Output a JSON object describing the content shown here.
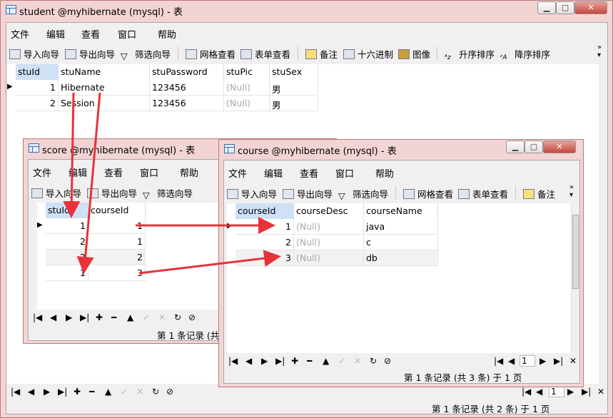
{
  "student": {
    "title": "student @myhibernate (mysql) - 表",
    "menu": [
      "文件",
      "编辑",
      "查看",
      "窗口",
      "帮助"
    ],
    "toolbar": [
      "导入向导",
      "导出向导",
      "筛选向导",
      "网格查看",
      "表单查看",
      "备注",
      "十六进制",
      "图像",
      "升序排序",
      "降序排序"
    ],
    "columns": [
      "stuId",
      "stuName",
      "stuPassword",
      "stuPic",
      "stuSex"
    ],
    "rows": [
      [
        "1",
        "Hibernate",
        "123456",
        "(Null)",
        "男"
      ],
      [
        "2",
        "Session",
        "123456",
        "(Null)",
        "男"
      ]
    ],
    "page": "1",
    "status": "第 1 条记录 (共 2 条) 于 1 页"
  },
  "score": {
    "title": "score @myhibernate (mysql) - 表",
    "menu": [
      "文件",
      "编辑",
      "查看",
      "窗口",
      "帮助"
    ],
    "toolbar": [
      "导入向导",
      "导出向导",
      "筛选向导"
    ],
    "columns": [
      "stuId",
      "courseId"
    ],
    "rows": [
      [
        "1",
        "1"
      ],
      [
        "2",
        "1"
      ],
      [
        "2",
        "2"
      ],
      [
        "1",
        "3"
      ]
    ],
    "status": "第 1 条记录 (共"
  },
  "course": {
    "title": "course @myhibernate (mysql) - 表",
    "menu": [
      "文件",
      "编辑",
      "查看",
      "窗口",
      "帮助"
    ],
    "toolbar": [
      "导入向导",
      "导出向导",
      "筛选向导",
      "网格查看",
      "表单查看",
      "备注"
    ],
    "columns": [
      "courseId",
      "courseDesc",
      "courseName"
    ],
    "rows": [
      [
        "1",
        "(Null)",
        "java"
      ],
      [
        "2",
        "(Null)",
        "c"
      ],
      [
        "3",
        "(Null)",
        "db"
      ]
    ],
    "page": "1",
    "status": "第 1 条记录 (共 3 条) 于 1 页"
  },
  "colors": {
    "frame": "#f3d4d4",
    "arrow": "#e8323a",
    "selected_header": "#cfe1f7"
  }
}
